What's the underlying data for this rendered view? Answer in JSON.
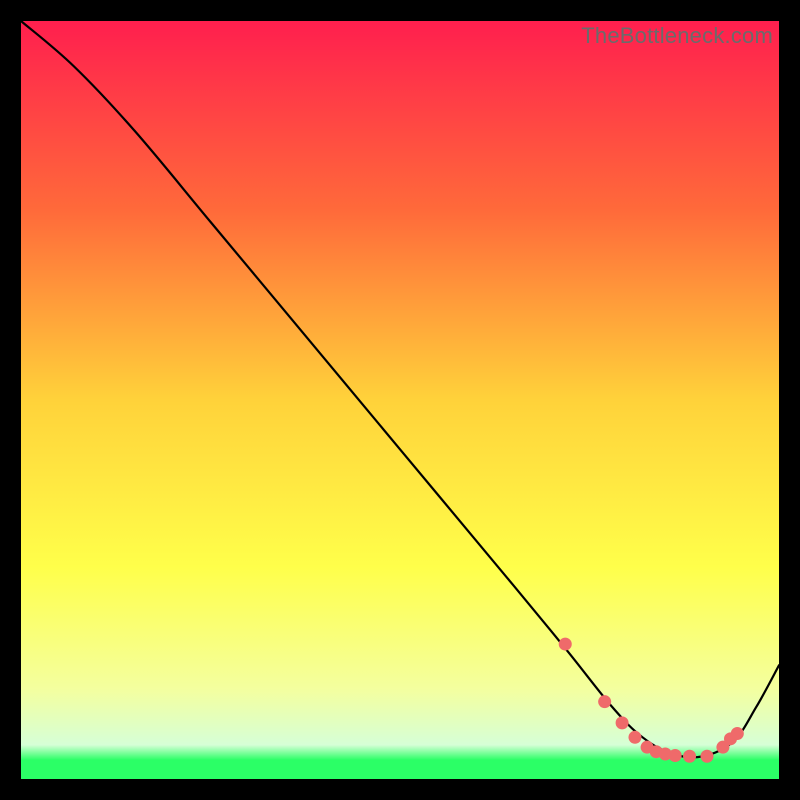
{
  "watermark": "TheBottleneck.com",
  "chart_data": {
    "type": "line",
    "title": "",
    "xlabel": "",
    "ylabel": "",
    "xlim": [
      0,
      100
    ],
    "ylim": [
      0,
      100
    ],
    "grid": false,
    "series": [
      {
        "name": "curve",
        "color": "#000000",
        "x": [
          0,
          7,
          15,
          25,
          35,
          45,
          55,
          65,
          72,
          78,
          82,
          86,
          90,
          94,
          97,
          100
        ],
        "y": [
          100,
          94,
          85.5,
          73.5,
          61.5,
          49.5,
          37.5,
          25.5,
          17,
          9.5,
          5.5,
          3.3,
          3.0,
          5.0,
          9.5,
          15
        ]
      }
    ],
    "markers": {
      "name": "dots",
      "color": "#ef6a6a",
      "radius_px": 6.5,
      "x": [
        71.8,
        77.0,
        79.3,
        81.0,
        82.6,
        83.8,
        85.0,
        86.3,
        88.2,
        90.5,
        92.6,
        93.6,
        94.5
      ],
      "y": [
        17.8,
        10.2,
        7.4,
        5.5,
        4.2,
        3.6,
        3.3,
        3.1,
        3.0,
        3.0,
        4.2,
        5.3,
        6.0
      ]
    },
    "gradient_stops": [
      {
        "offset": 0.0,
        "color": "#ff1f4e"
      },
      {
        "offset": 0.25,
        "color": "#ff6a3a"
      },
      {
        "offset": 0.5,
        "color": "#ffd23a"
      },
      {
        "offset": 0.72,
        "color": "#ffff4a"
      },
      {
        "offset": 0.88,
        "color": "#f4ff9e"
      },
      {
        "offset": 0.955,
        "color": "#d6ffd6"
      },
      {
        "offset": 0.975,
        "color": "#2bff66"
      },
      {
        "offset": 1.0,
        "color": "#2bff66"
      }
    ]
  }
}
